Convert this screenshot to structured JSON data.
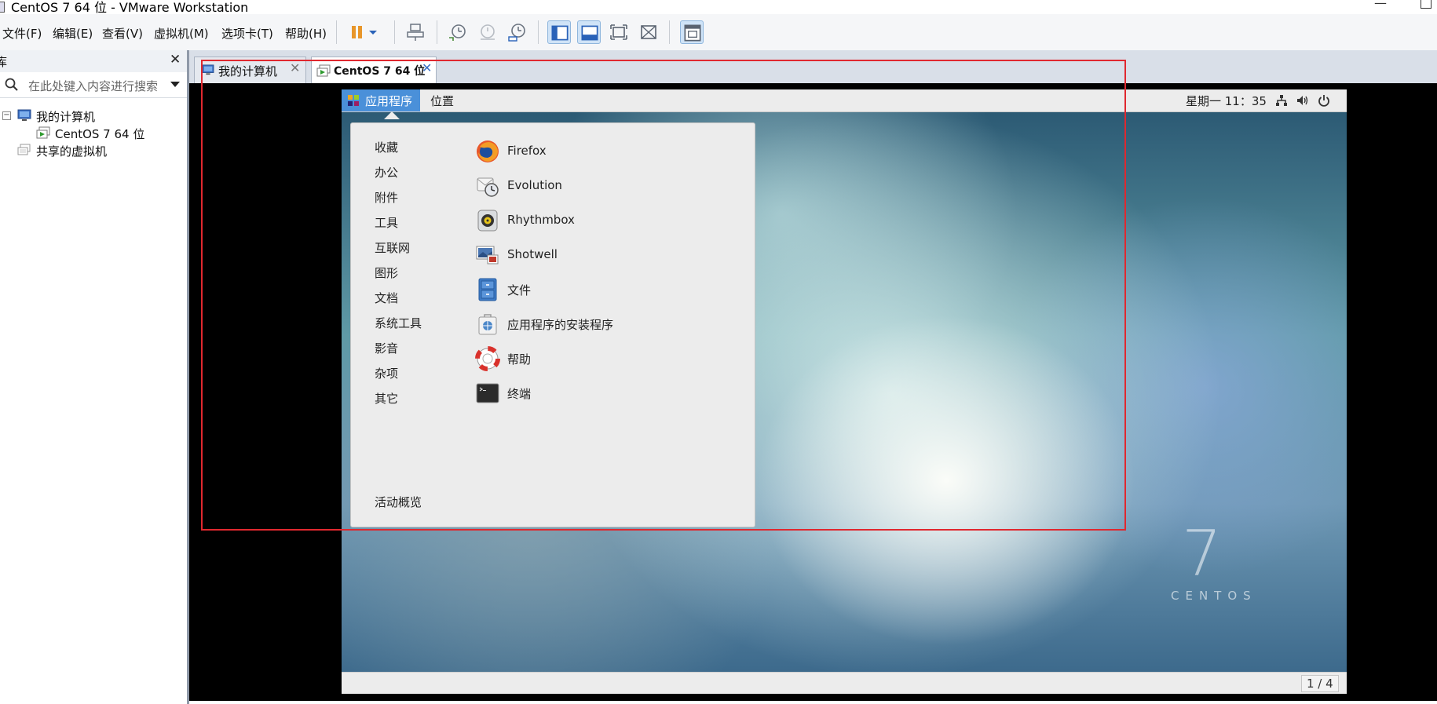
{
  "window": {
    "title": "CentOS 7 64 位 - VMware Workstation"
  },
  "menu": [
    {
      "label": "文件(F)"
    },
    {
      "label": "编辑(E)"
    },
    {
      "label": "查看(V)"
    },
    {
      "label": "虚拟机(M)"
    },
    {
      "label": "选项卡(T)"
    },
    {
      "label": "帮助(H)"
    }
  ],
  "toolbar": {
    "icons": [
      "pause-icon",
      "dropdown-caret-icon",
      "send-keys-icon",
      "snapshot-take-icon",
      "snapshot-revert-icon",
      "snapshot-manager-icon",
      "sidebar-view-icon",
      "thumbnail-bar-icon",
      "fullscreen-icon",
      "unity-icon",
      "console-view-icon"
    ]
  },
  "library": {
    "title": "库",
    "search_placeholder": "在此处键入内容进行搜索",
    "tree": [
      {
        "label": "我的计算机"
      },
      {
        "label": "CentOS 7 64 位"
      },
      {
        "label": "共享的虚拟机"
      }
    ]
  },
  "tabs": [
    {
      "label": "我的计算机",
      "active": false
    },
    {
      "label": "CentOS 7 64 位",
      "active": true
    }
  ],
  "guest": {
    "topbar": {
      "applications": "应用程序",
      "places": "位置",
      "clock": "星期一 11：35"
    },
    "categories": [
      "收藏",
      "办公",
      "附件",
      "工具",
      "互联网",
      "图形",
      "文档",
      "系统工具",
      "影音",
      "杂项",
      "其它"
    ],
    "apps": [
      {
        "label": "Firefox",
        "icon": "firefox-icon"
      },
      {
        "label": "Evolution",
        "icon": "evolution-icon"
      },
      {
        "label": "Rhythmbox",
        "icon": "rhythmbox-icon"
      },
      {
        "label": "Shotwell",
        "icon": "shotwell-icon"
      },
      {
        "label": "文件",
        "icon": "files-icon"
      },
      {
        "label": "应用程序的安装程序",
        "icon": "software-installer-icon"
      },
      {
        "label": "帮助",
        "icon": "help-icon"
      },
      {
        "label": "终端",
        "icon": "terminal-icon"
      }
    ],
    "overview": "活动概览",
    "wallpaper": {
      "number": "7",
      "word": "CENTOS"
    },
    "workspace_counter": "1 / 4"
  },
  "colors": {
    "accent": "#4a90d9",
    "annotation": "#e0282f"
  }
}
